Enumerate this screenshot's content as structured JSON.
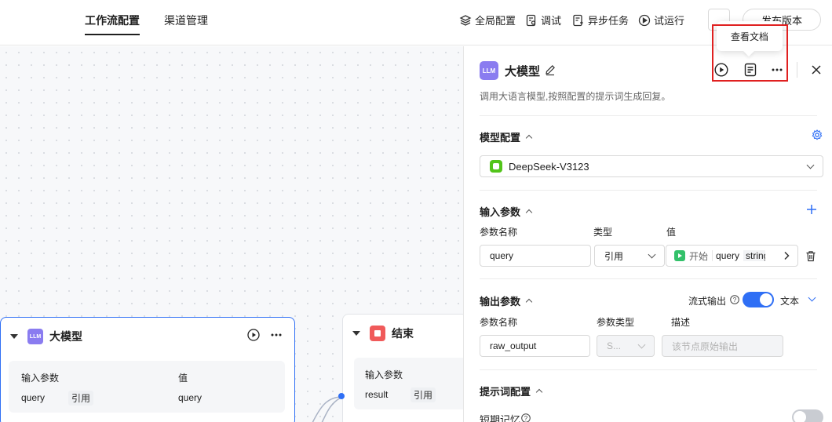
{
  "topbar": {
    "tabs": [
      {
        "label": "工作流配置",
        "active": true
      },
      {
        "label": "渠道管理",
        "active": false
      }
    ],
    "actions": [
      {
        "label": "全局配置",
        "icon": "layers-icon"
      },
      {
        "label": "调试",
        "icon": "debug-icon"
      },
      {
        "label": "异步任务",
        "icon": "async-task-icon"
      },
      {
        "label": "试运行",
        "icon": "play-circle-icon"
      }
    ],
    "publish_label": "发布版本"
  },
  "tooltip": {
    "text": "查看文档"
  },
  "canvas": {
    "llm_node": {
      "title": "大模型",
      "badge": "LLM",
      "col_input": "输入参数",
      "col_value": "值",
      "row_name": "query",
      "row_tag": "引用",
      "row_value": "query"
    },
    "end_node": {
      "title": "结束",
      "col_input": "输入参数",
      "row_name": "result",
      "row_tag": "引用"
    }
  },
  "panel": {
    "badge": "LLM",
    "title": "大模型",
    "description": "调用大语言模型,按照配置的提示词生成回复。",
    "model_section": {
      "title": "模型配置",
      "model_name": "DeepSeek-V3123"
    },
    "input_section": {
      "title": "输入参数",
      "col_name": "参数名称",
      "col_type": "类型",
      "col_value": "值",
      "param_name": "query",
      "param_type": "引用",
      "ref_node": "开始",
      "ref_var": "query",
      "ref_type": "string"
    },
    "output_section": {
      "title": "输出参数",
      "stream_label": "流式输出",
      "stream_on": true,
      "format_label": "文本",
      "col_name": "参数名称",
      "col_type": "参数类型",
      "col_desc": "描述",
      "param_name": "raw_output",
      "param_type": "S...",
      "desc_placeholder": "该节点原始输出"
    },
    "prompt_section": {
      "title": "提示词配置",
      "memory_label": "短期记忆",
      "memory_on": false
    }
  },
  "colors": {
    "accent": "#2f6ff5",
    "llm_badge": "#8a7cf0",
    "end_badge": "#f05a5a",
    "model_icon": "#52c41a",
    "highlight": "#e02020"
  }
}
